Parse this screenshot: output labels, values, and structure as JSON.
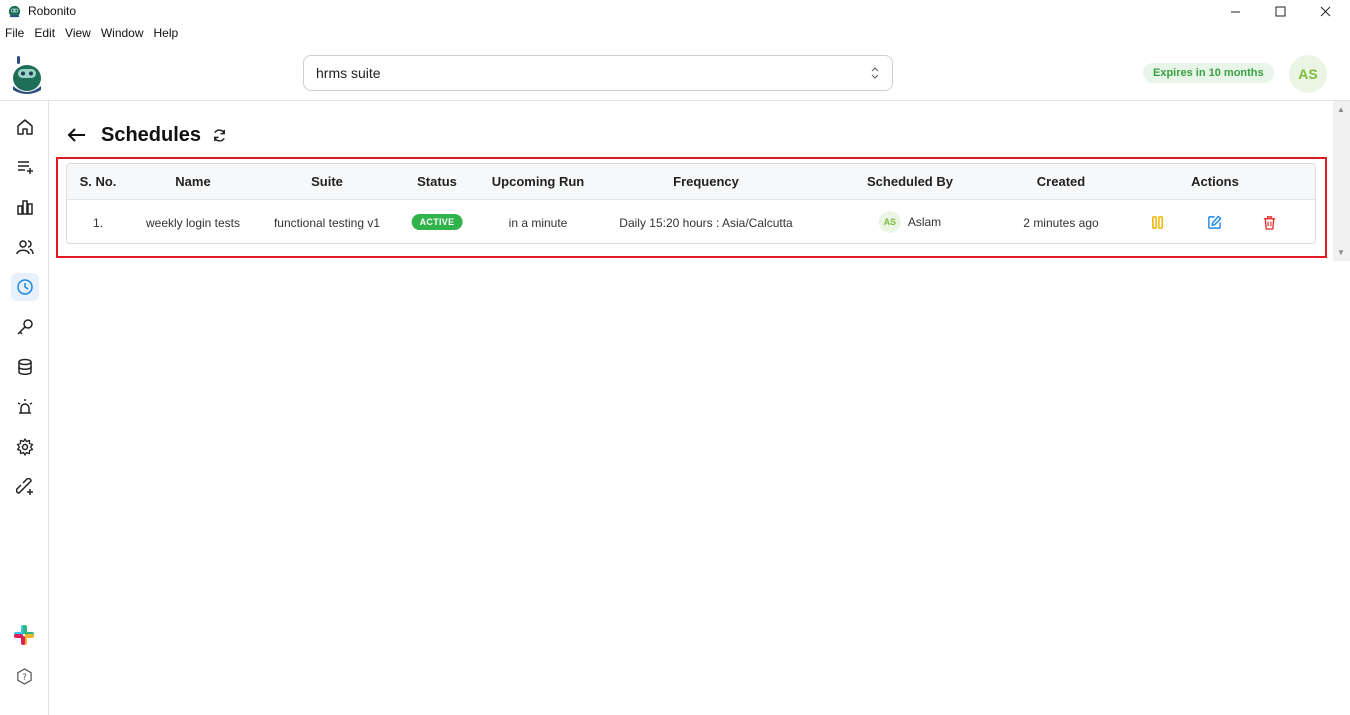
{
  "window": {
    "title": "Robonito"
  },
  "menu": [
    "File",
    "Edit",
    "View",
    "Window",
    "Help"
  ],
  "header": {
    "suite_select": "hrms suite",
    "expiry": "Expires in 10 months",
    "user_initials": "AS"
  },
  "page": {
    "title": "Schedules"
  },
  "table": {
    "headers": {
      "sno": "S. No.",
      "name": "Name",
      "suite": "Suite",
      "status": "Status",
      "upcoming": "Upcoming Run",
      "frequency": "Frequency",
      "scheduled_by": "Scheduled By",
      "created": "Created",
      "actions": "Actions"
    },
    "rows": [
      {
        "sno": "1.",
        "name": "weekly login tests",
        "suite": "functional testing v1",
        "status": "ACTIVE",
        "upcoming": "in a minute",
        "frequency": "Daily 15:20 hours : Asia/Calcutta",
        "scheduled_by_initials": "AS",
        "scheduled_by": "Aslam",
        "created": "2 minutes ago"
      }
    ]
  },
  "colors": {
    "accent": "#1e88e5",
    "active_badge": "#2fb34a",
    "pause": "#f0b400",
    "edit": "#1e88e5",
    "delete": "#e53935",
    "highlight": "#e11b22"
  },
  "icons": {
    "sidebar": [
      "home-icon",
      "test-list-icon",
      "reports-icon",
      "users-icon",
      "schedules-icon",
      "key-icon",
      "database-icon",
      "alarm-icon",
      "settings-icon",
      "integrations-icon"
    ],
    "actions": [
      "pause-icon",
      "edit-icon",
      "delete-icon"
    ]
  }
}
